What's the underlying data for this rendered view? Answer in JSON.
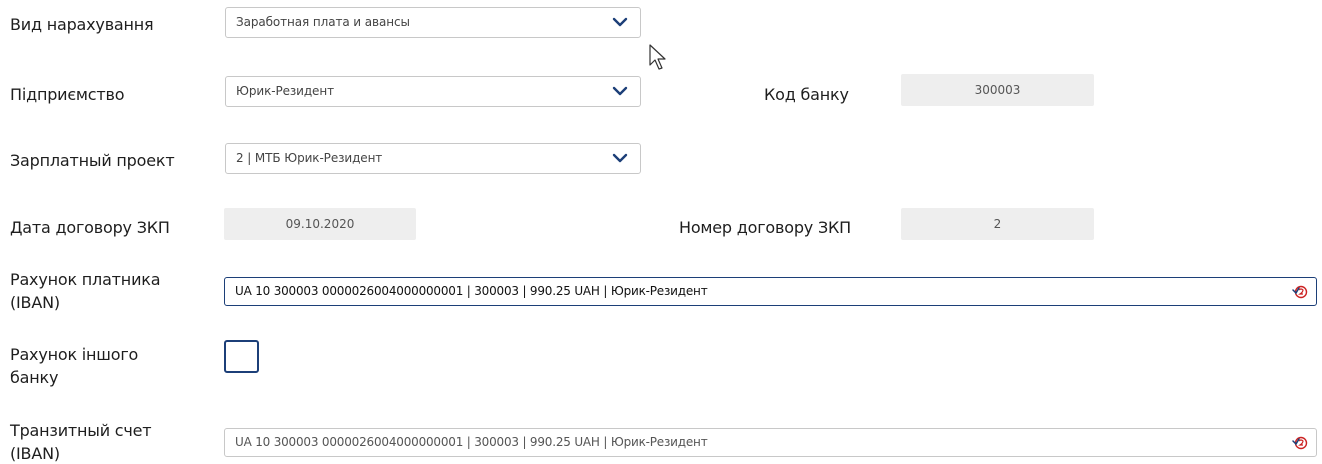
{
  "form": {
    "accrual_type": {
      "label": "Вид нарахування",
      "value": "Заработная плата и авансы",
      "icon": "chevron-down-icon"
    },
    "enterprise": {
      "label": "Підприємство",
      "value": "Юрик-Резидент",
      "icon": "chevron-down-icon"
    },
    "bank_code": {
      "label": "Код банку",
      "value": "300003"
    },
    "salary_project": {
      "label": "Зарплатный проект",
      "value": "2 | МТБ Юрик-Резидент",
      "icon": "chevron-down-icon"
    },
    "contract_date": {
      "label": "Дата договору ЗКП",
      "value": "09.10.2020"
    },
    "contract_number": {
      "label": "Номер договору ЗКП",
      "value": "2"
    },
    "payer_account": {
      "label_line1": "Рахунок платника",
      "label_line2": "(IBAN)",
      "value": "UA 10 300003 0000026004000000001 | 300003 | 990.25 UAH | Юрик-Резидент",
      "icon": "clear-icon"
    },
    "other_bank_account": {
      "label_line1": "Рахунок іншого",
      "label_line2": "банку",
      "checked": false
    },
    "transit_account": {
      "label_line1": "Транзитный счет",
      "label_line2": "(IBAN)",
      "value": "UA 10 300003 0000026004000000001 | 300003 | 990.25 UAH | Юрик-Резидент",
      "icon": "clear-icon"
    }
  },
  "colors": {
    "accent": "#1c3f78",
    "border": "#c8c8c8",
    "readonly_bg": "#eeeeee",
    "clear_icon": "#cc2222"
  }
}
